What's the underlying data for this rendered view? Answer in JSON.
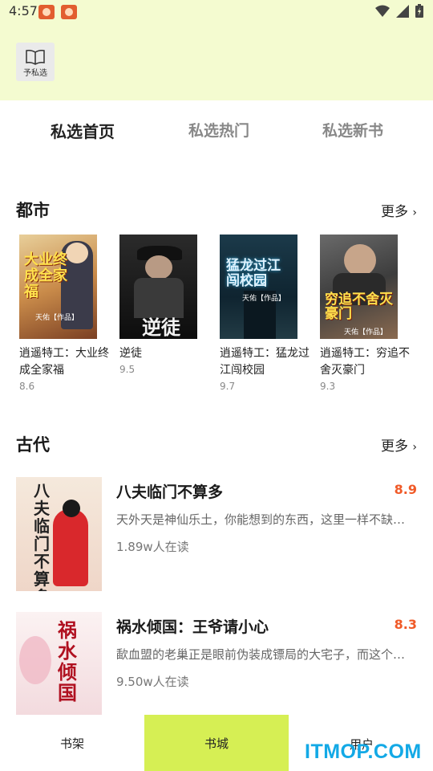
{
  "status_bar": {
    "time": "4:57",
    "icons": [
      "app-notification-icon",
      "app-notification-icon",
      "wifi-icon",
      "signal-icon",
      "battery-icon"
    ]
  },
  "header": {
    "logo_text": "予私选",
    "logo_icon": "open-book-icon",
    "background": "#f4fbd0"
  },
  "tabs": [
    {
      "label": "私选首页",
      "active": true
    },
    {
      "label": "私选热门",
      "active": false
    },
    {
      "label": "私选新书",
      "active": false
    }
  ],
  "sections": {
    "urban": {
      "title": "都市",
      "more_label": "更多",
      "books": [
        {
          "title": "逍遥特工：大业终成全家福",
          "score": "8.6",
          "cover_text": "大业终成全家福",
          "cover_author": "天佑【作品】"
        },
        {
          "title": "逆徒",
          "score": "9.5",
          "cover_text": "逆徒",
          "cover_author": ""
        },
        {
          "title": "逍遥特工：猛龙过江闯校园",
          "score": "9.7",
          "cover_text": "猛龙过江闯校园",
          "cover_author": "天佑【作品】"
        },
        {
          "title": "逍遥特工：穷追不舍灭豪门",
          "score": "9.3",
          "cover_text": "穷追不舍灭豪门",
          "cover_author": "天佑【作品】"
        }
      ]
    },
    "ancient": {
      "title": "古代",
      "more_label": "更多",
      "books": [
        {
          "title": "八夫临门不算多",
          "score": "8.9",
          "description": "天外天是神仙乐土，你能想到的东西，这里一样不缺全…",
          "readers": "1.89w人在读",
          "cover_text": "八夫临门不算多"
        },
        {
          "title": "祸水倾国：王爷请小心",
          "score": "8.3",
          "description": "歃血盟的老巢正是眼前伪装成镖局的大宅子，而这个男…",
          "readers": "9.50w人在读",
          "cover_text": "祸水倾国"
        }
      ]
    }
  },
  "bottom_nav": [
    {
      "label": "书架",
      "active": false
    },
    {
      "label": "书城",
      "active": true
    },
    {
      "label": "用户",
      "active": false
    }
  ],
  "watermark": "ITMOP.COM",
  "colors": {
    "accent": "#d6ef54",
    "score": "#f05a28",
    "watermark": "#13a9e6"
  }
}
